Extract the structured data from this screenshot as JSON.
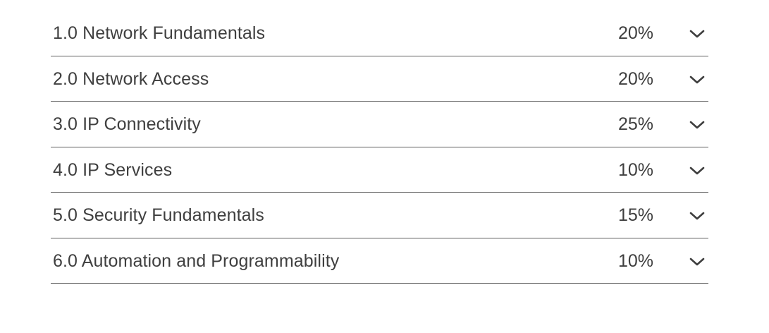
{
  "accordion": {
    "items": [
      {
        "title": "1.0 Network Fundamentals",
        "weight": "20%",
        "icon": "chevron-down-icon"
      },
      {
        "title": "2.0 Network Access",
        "weight": "20%",
        "icon": "chevron-down-icon"
      },
      {
        "title": "3.0 IP Connectivity",
        "weight": "25%",
        "icon": "chevron-down-icon"
      },
      {
        "title": "4.0 IP Services",
        "weight": "10%",
        "icon": "chevron-down-icon"
      },
      {
        "title": "5.0 Security Fundamentals",
        "weight": "15%",
        "icon": "chevron-down-icon"
      },
      {
        "title": "6.0 Automation and Programmability",
        "weight": "10%",
        "icon": "chevron-down-icon"
      }
    ]
  },
  "colors": {
    "text": "#3f3f3f",
    "divider": "#5e5e5e",
    "background": "#ffffff"
  }
}
